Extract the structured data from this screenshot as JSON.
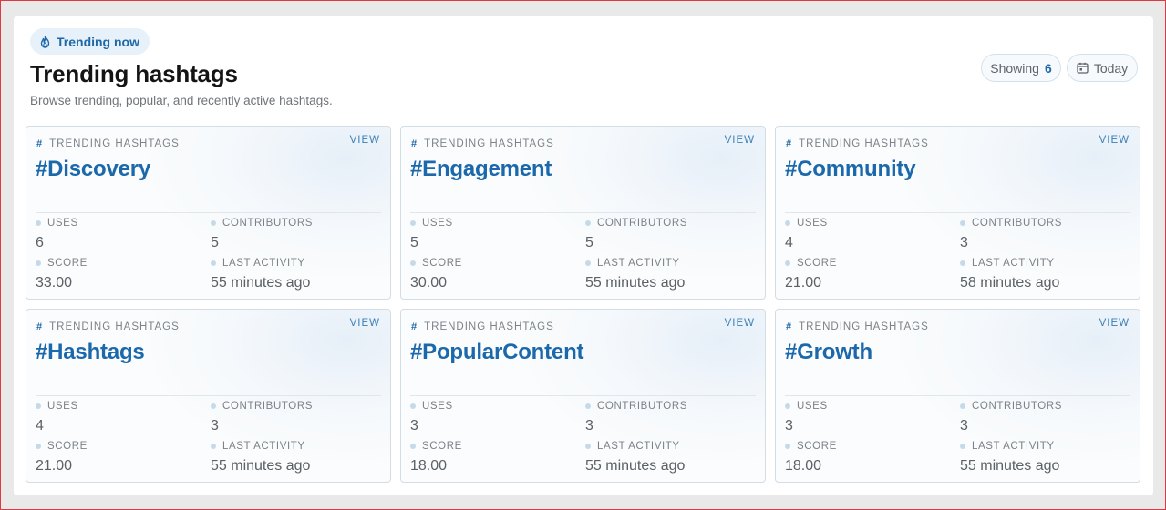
{
  "header": {
    "badge_label": "Trending now",
    "title": "Trending hashtags",
    "subtitle": "Browse trending, popular, and recently active hashtags.",
    "showing_label": "Showing",
    "showing_count": "6",
    "date_filter_label": "Today"
  },
  "labels": {
    "kicker": "TRENDING HASHTAGS",
    "kicker_hash": "#",
    "view": "VIEW",
    "uses": "USES",
    "contributors": "CONTRIBUTORS",
    "score": "SCORE",
    "last_activity": "LAST ACTIVITY"
  },
  "cards": [
    {
      "tag": "#Discovery",
      "uses": "6",
      "contributors": "5",
      "score": "33.00",
      "last_activity": "55 minutes ago"
    },
    {
      "tag": "#Engagement",
      "uses": "5",
      "contributors": "5",
      "score": "30.00",
      "last_activity": "55 minutes ago"
    },
    {
      "tag": "#Community",
      "uses": "4",
      "contributors": "3",
      "score": "21.00",
      "last_activity": "58 minutes ago"
    },
    {
      "tag": "#Hashtags",
      "uses": "4",
      "contributors": "3",
      "score": "21.00",
      "last_activity": "55 minutes ago"
    },
    {
      "tag": "#PopularContent",
      "uses": "3",
      "contributors": "3",
      "score": "18.00",
      "last_activity": "55 minutes ago"
    },
    {
      "tag": "#Growth",
      "uses": "3",
      "contributors": "3",
      "score": "18.00",
      "last_activity": "55 minutes ago"
    }
  ],
  "icons": {
    "badge": "flame-icon",
    "date_filter": "calendar-icon"
  },
  "colors": {
    "accent": "#1f68a7",
    "frame_border": "#e0393e"
  }
}
